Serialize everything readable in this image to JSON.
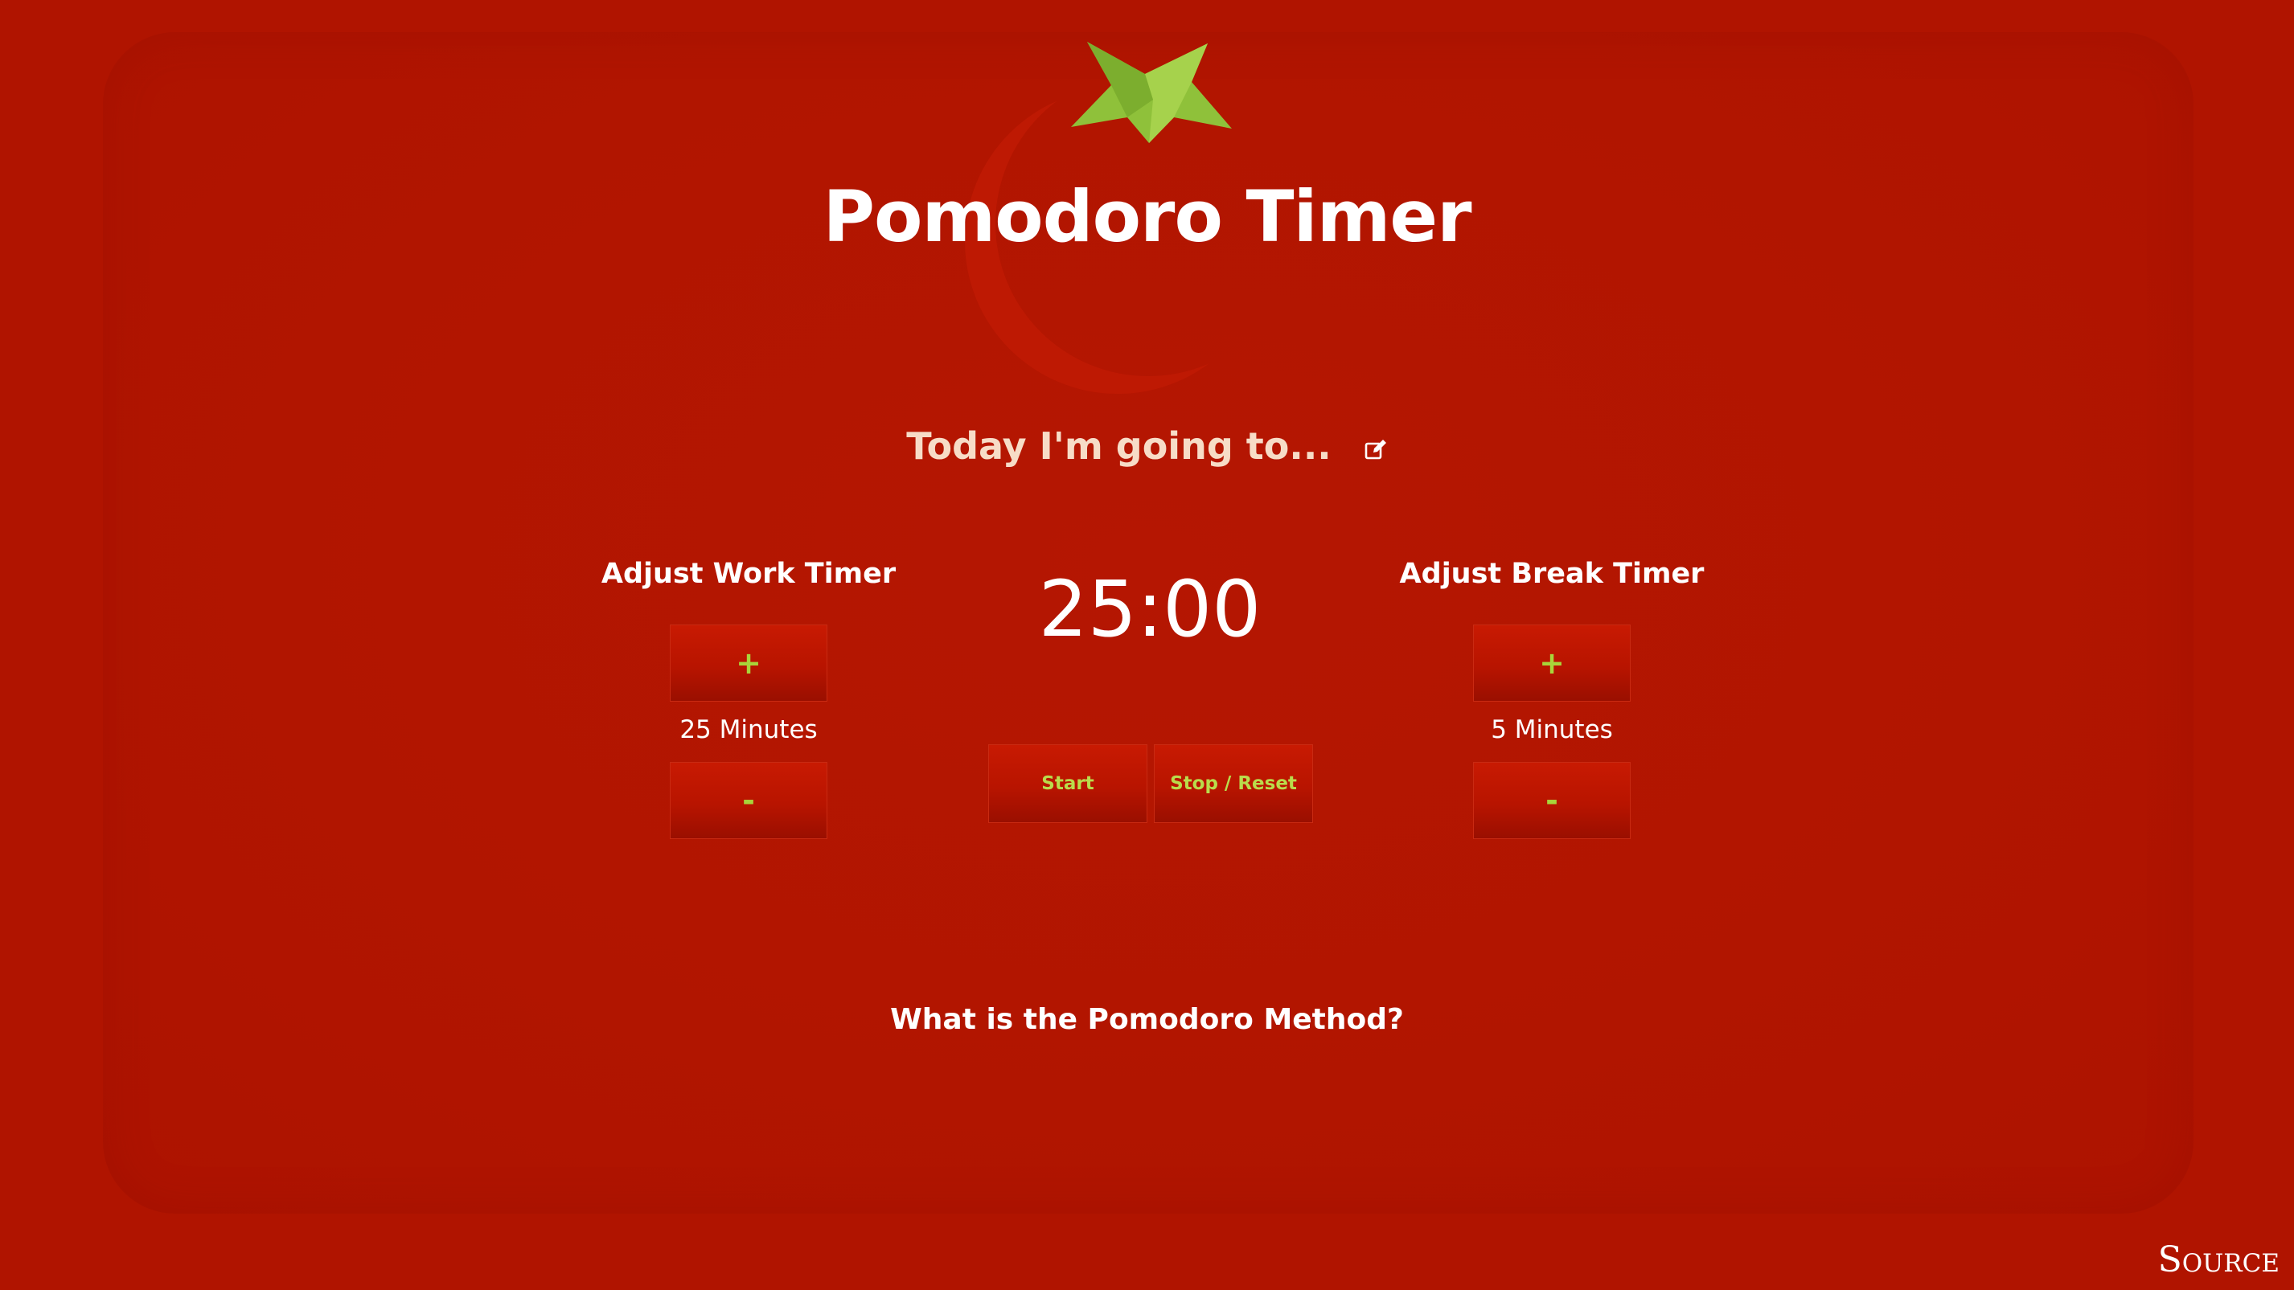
{
  "app": {
    "title": "Pomodoro Timer"
  },
  "task": {
    "prompt": "Today I'm going to...",
    "edit_icon": "edit-icon"
  },
  "work_timer": {
    "heading": "Adjust Work Timer",
    "plus_label": "+",
    "minus_label": "-",
    "value_label": "25 Minutes"
  },
  "break_timer": {
    "heading": "Adjust Break Timer",
    "plus_label": "+",
    "minus_label": "-",
    "value_label": "5 Minutes"
  },
  "clock": {
    "display": "25:00"
  },
  "controls": {
    "start_label": "Start",
    "stop_reset_label": "Stop / Reset"
  },
  "footer": {
    "method_link": "What is the Pomodoro Method?",
    "source_link": "Source"
  },
  "colors": {
    "background": "#b01400",
    "button_text": "#a8d43a",
    "leaf": "#8fc13a",
    "task_text": "#f7dcc7"
  }
}
